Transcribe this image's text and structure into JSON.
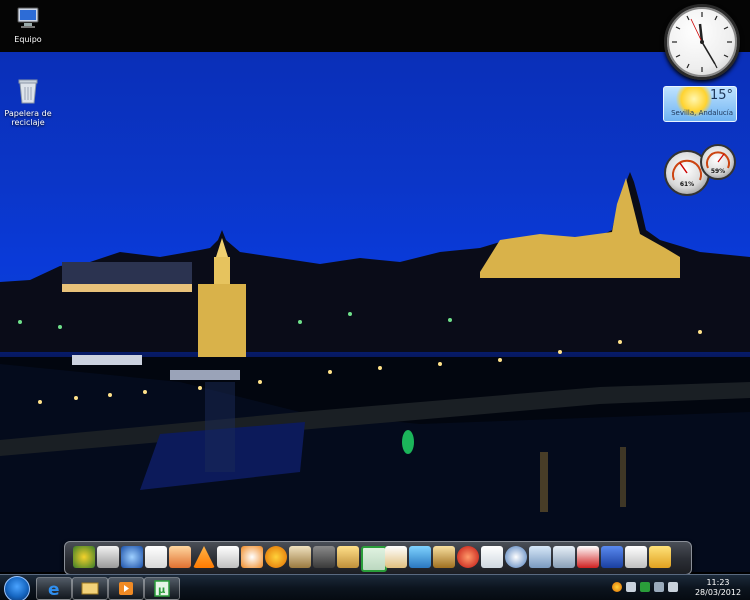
{
  "desktop": {
    "icons": [
      {
        "label": "Equipo",
        "icon": "computer-icon"
      },
      {
        "label": "Papelera de reciclaje",
        "icon": "recycle-bin-icon"
      }
    ]
  },
  "gadgets": {
    "clock": {
      "time": "11:23"
    },
    "weather": {
      "temperature": "15°",
      "location": "Sevilla, Andalucía"
    },
    "meters": [
      {
        "value": "61%"
      },
      {
        "value": "59%"
      }
    ]
  },
  "dock": {
    "items": [
      "globe-icon",
      "gamepad-icon",
      "earth-icon",
      "document-icon",
      "pen-icon",
      "vlc-icon",
      "calendar-icon",
      "eye-icon",
      "avast-icon",
      "tools-icon",
      "hard-drive-icon",
      "folder-icon",
      "utorrent-icon",
      "brush-icon",
      "cube-icon",
      "pencil-icon",
      "red-app-icon",
      "notes-icon",
      "network-icon",
      "folders-icon",
      "scanner-icon",
      "antivirus-icon",
      "word-icon",
      "hands-icon",
      "plane-icon"
    ]
  },
  "taskbar": {
    "start": "windows-start-icon",
    "pinned": [
      "internet-explorer-icon",
      "file-explorer-icon",
      "media-player-icon",
      "utorrent-icon"
    ],
    "tray": [
      "avast-tray-icon",
      "flag-icon",
      "utorrent-tray-icon",
      "network-icon",
      "volume-icon"
    ],
    "clock": {
      "time": "11:23",
      "date": "28/03/2012"
    }
  },
  "colors": {
    "sky": "#0b3fd6",
    "taskbar": "#0c141e",
    "dock": "#2d3037"
  }
}
